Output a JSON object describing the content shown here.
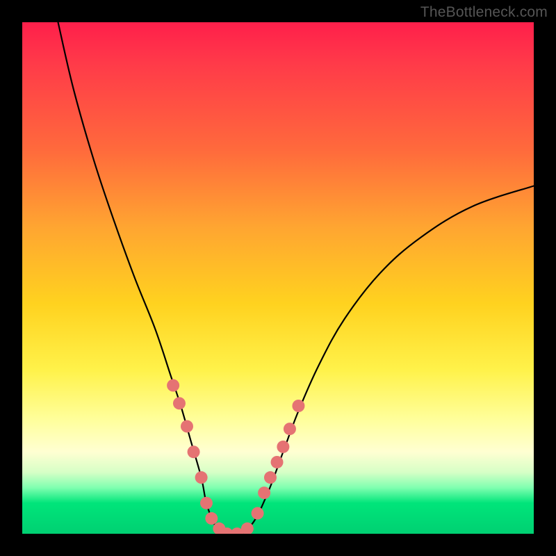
{
  "watermark": {
    "text": "TheBottleneck.com"
  },
  "chart_data": {
    "type": "line",
    "title": "",
    "xlabel": "",
    "ylabel": "",
    "xlim": [
      0,
      100
    ],
    "ylim": [
      0,
      100
    ],
    "series": [
      {
        "name": "bottleneck-curve",
        "x": [
          7,
          10,
          14,
          18,
          22,
          26,
          29,
          31,
          33,
          35,
          36,
          37.5,
          39,
          42,
          45,
          48,
          51,
          54,
          58,
          63,
          70,
          78,
          88,
          100
        ],
        "values": [
          100,
          87,
          73,
          61,
          50,
          40,
          31,
          25,
          18,
          11,
          6,
          2,
          0,
          0,
          2,
          8,
          16,
          24,
          33,
          42,
          51,
          58,
          64,
          68
        ]
      }
    ],
    "markers": {
      "name": "highlight-dots",
      "x": [
        29.5,
        30.7,
        32.2,
        33.5,
        35.0,
        36.0,
        37.0,
        38.5,
        40.0,
        42.0,
        44.0,
        46.0,
        47.3,
        48.5,
        49.8,
        51.0,
        52.3,
        54.0
      ],
      "values": [
        29,
        25.5,
        21,
        16,
        11,
        6,
        3,
        1,
        0,
        0,
        1,
        4,
        8,
        11,
        14,
        17,
        20.5,
        25
      ],
      "color": "#e57373",
      "radius_px": 9
    },
    "background_gradient": {
      "orientation": "vertical",
      "stops": [
        {
          "pos": 0.0,
          "color": "#ff1f4b"
        },
        {
          "pos": 0.25,
          "color": "#ff6a3c"
        },
        {
          "pos": 0.55,
          "color": "#ffd21f"
        },
        {
          "pos": 0.8,
          "color": "#ffffb0"
        },
        {
          "pos": 0.92,
          "color": "#5fffa0"
        },
        {
          "pos": 1.0,
          "color": "#00d072"
        }
      ]
    }
  }
}
